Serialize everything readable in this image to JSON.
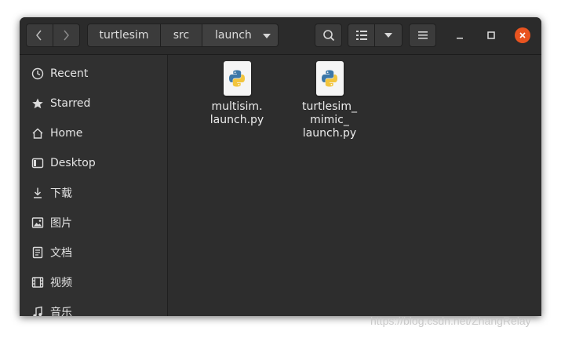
{
  "path": {
    "crumbs": [
      "turtlesim",
      "src",
      "launch"
    ]
  },
  "sidebar": {
    "items": [
      {
        "label": "Recent",
        "icon": "clock-icon"
      },
      {
        "label": "Starred",
        "icon": "star-icon"
      },
      {
        "label": "Home",
        "icon": "home-icon"
      },
      {
        "label": "Desktop",
        "icon": "desktop-icon"
      },
      {
        "label": "下载",
        "icon": "download-icon"
      },
      {
        "label": "图片",
        "icon": "pictures-icon"
      },
      {
        "label": "文档",
        "icon": "documents-icon"
      },
      {
        "label": "视频",
        "icon": "videos-icon"
      },
      {
        "label": "音乐",
        "icon": "music-icon"
      }
    ]
  },
  "files": [
    {
      "name": "multisim.\nlaunch.py",
      "icon": "python-file-icon"
    },
    {
      "name": "turtlesim_\nmimic_\nlaunch.py",
      "icon": "python-file-icon"
    }
  ],
  "watermark": "https://blog.csdn.net/ZhangRelay",
  "colors": {
    "close_button": "#e95420",
    "window_bg": "#2d2d2d",
    "sidebar_bg": "#303030"
  }
}
